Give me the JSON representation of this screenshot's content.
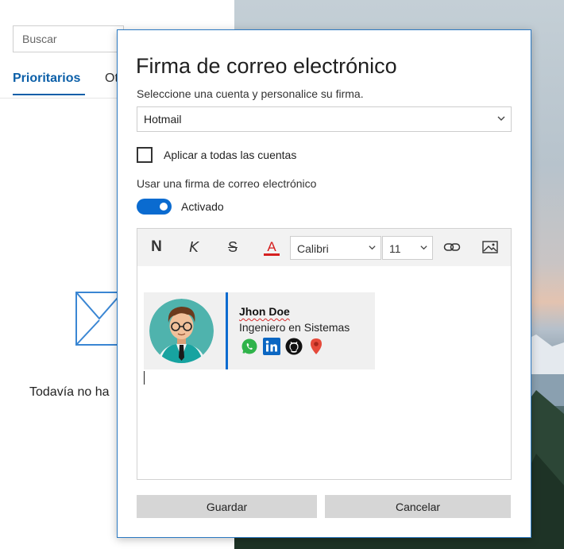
{
  "background_app": {
    "search_placeholder": "Buscar",
    "tabs": [
      {
        "label": "Prioritarios",
        "active": true
      },
      {
        "label": "Ot",
        "active": false
      }
    ],
    "empty_message": "Todavía no ha"
  },
  "dialog": {
    "title": "Firma de correo electrónico",
    "subtitle": "Seleccione una cuenta y personalice su firma.",
    "account_select": {
      "value": "Hotmail"
    },
    "apply_all": {
      "label": "Aplicar a todas las cuentas",
      "checked": false
    },
    "use_signature_label": "Usar una firma de correo electrónico",
    "toggle": {
      "label": "Activado",
      "on": true
    },
    "toolbar": {
      "bold": "N",
      "italic": "K",
      "strike": "S",
      "font_color": "A",
      "font_name": "Calibri",
      "font_size": "11",
      "icons": [
        "bold-icon",
        "italic-icon",
        "strikethrough-icon",
        "font-color-icon",
        "link-icon",
        "image-icon"
      ]
    },
    "signature": {
      "name": "Jhon Doe",
      "role": "Ingeniero en Sistemas",
      "social_icons": [
        "whatsapp-icon",
        "linkedin-icon",
        "github-icon",
        "location-pin-icon"
      ]
    },
    "buttons": {
      "save": "Guardar",
      "cancel": "Cancelar"
    }
  },
  "colors": {
    "accent": "#0a6bd0",
    "tab_active": "#0b5fa8",
    "font_color_indicator": "#d51f1f",
    "button_bg": "#d6d6d6"
  }
}
